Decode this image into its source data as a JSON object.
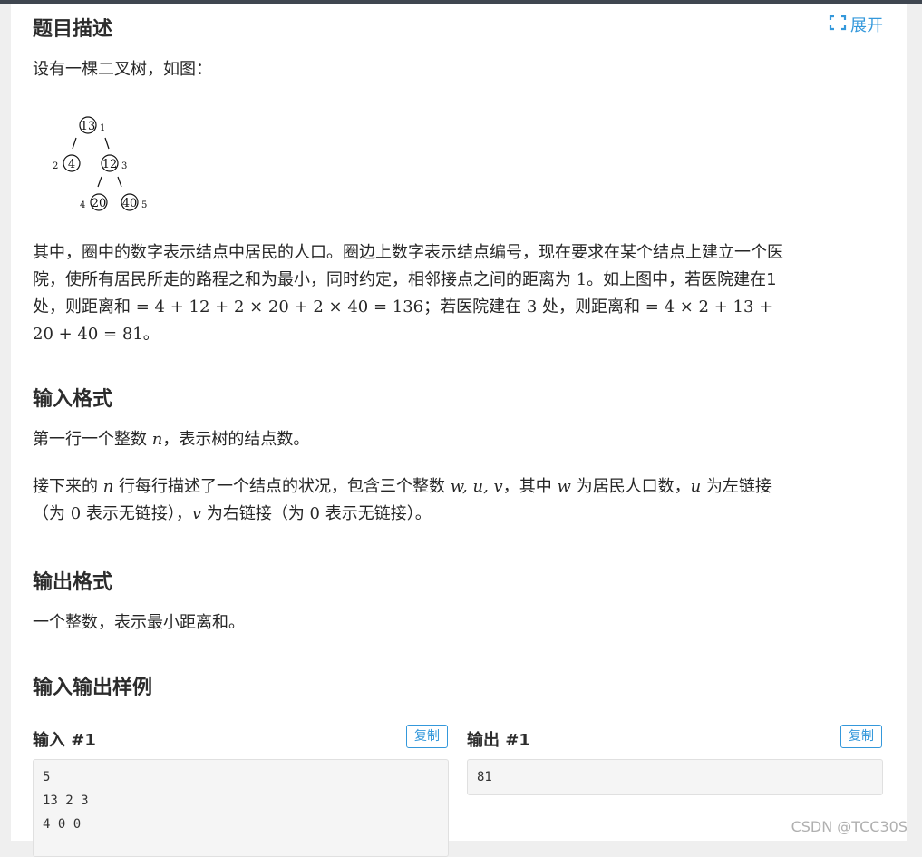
{
  "headings": {
    "description": "题目描述",
    "input_format": "输入格式",
    "output_format": "输出格式",
    "samples": "输入输出样例"
  },
  "expand_label": "展开",
  "description": {
    "intro": "设有一棵二叉树，如图：",
    "tree_nodes": [
      {
        "value": "13",
        "index": "1"
      },
      {
        "value": "4",
        "index": "2"
      },
      {
        "value": "12",
        "index": "3"
      },
      {
        "value": "20",
        "index": "4"
      },
      {
        "value": "40",
        "index": "5"
      }
    ],
    "p1": "其中，圈中的数字表示结点中居民的人口。圈边上数字表示结点编号，现在要求在某个结点上建立一个医",
    "p2a": "院，使所有居民所走的路程之和为最小，同时约定，相邻接点之间的距离为 ",
    "p2b": "1",
    "p2c": "。如上图中，若医院建在1",
    "p3a": "处，则距离和 ",
    "p3b": "= 4 + 12 + 2 × 20 + 2 × 40 = 136",
    "p3c": "；若医院建在 ",
    "p3d": "3",
    "p3e": " 处，则距离和 ",
    "p3f": "= 4 × 2 + 13 +",
    "p4a": "20 + 40 = 81",
    "p4b": "。"
  },
  "input_format": {
    "line1a": "第一行一个整数 ",
    "line1b": "n",
    "line1c": "，表示树的结点数。",
    "line2a": "接下来的 ",
    "line2b": "n",
    "line2c": " 行每行描述了一个结点的状况，包含三个整数 ",
    "line2d": "w, u, v",
    "line2e": "，其中 ",
    "line2f": "w",
    "line2g": " 为居民人口数，",
    "line2h": "u",
    "line2i": " 为左链接",
    "line3a": "（为 ",
    "line3b": "0",
    "line3c": " 表示无链接），",
    "line3d": "v",
    "line3e": " 为右链接（为 ",
    "line3f": "0",
    "line3g": " 表示无链接）。"
  },
  "output_format": {
    "line1": "一个整数，表示最小距离和。"
  },
  "samples": {
    "input_label": "输入 #1",
    "output_label": "输出 #1",
    "copy_label": "复制",
    "input_lines": [
      "5",
      "13 2 3",
      "4 0 0"
    ],
    "output_lines": [
      "81"
    ]
  },
  "watermark": "CSDN @TCC30S",
  "colors": {
    "accent": "#3498db",
    "text": "#262626",
    "heading": "#2c2c2c"
  }
}
